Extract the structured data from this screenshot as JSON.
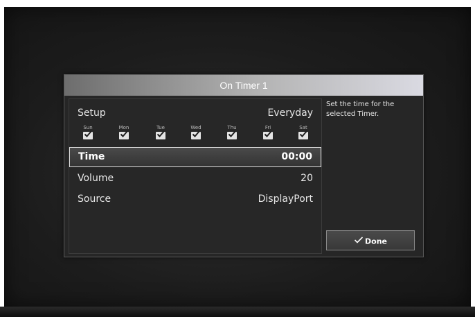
{
  "dialog": {
    "title": "On Timer 1"
  },
  "settings": {
    "setup": {
      "label": "Setup",
      "value": "Everyday"
    },
    "days": [
      {
        "name": "Sun",
        "checked": true
      },
      {
        "name": "Mon",
        "checked": true
      },
      {
        "name": "Tue",
        "checked": true
      },
      {
        "name": "Wed",
        "checked": true
      },
      {
        "name": "Thu",
        "checked": true
      },
      {
        "name": "Fri",
        "checked": true
      },
      {
        "name": "Sat",
        "checked": true
      }
    ],
    "time": {
      "label": "Time",
      "value": "00:00"
    },
    "volume": {
      "label": "Volume",
      "value": "20"
    },
    "source": {
      "label": "Source",
      "value": "DisplayPort"
    }
  },
  "help": {
    "text": "Set the time for the selected Timer."
  },
  "actions": {
    "done_label": "Done"
  },
  "colors": {
    "panel": "#262626",
    "highlight_border": "#e0e0e0",
    "text": "#e6e6e6"
  },
  "icons": {
    "check": "check-icon"
  }
}
